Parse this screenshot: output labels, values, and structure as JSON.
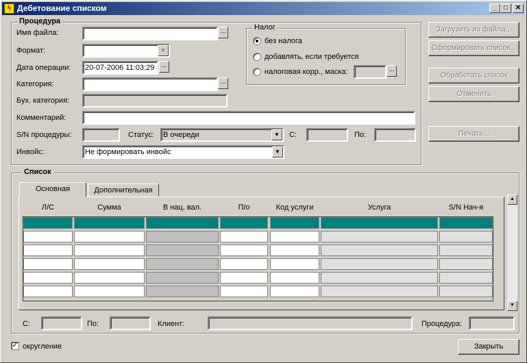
{
  "window": {
    "title": "Дебетование списком",
    "min": "_",
    "max": "□",
    "close": "✕"
  },
  "procedure": {
    "group_title": "Процедура",
    "filename_label": "Имя файла:",
    "format_label": "Формат:",
    "date_label": "Дата операции:",
    "date_value": "20-07-2006 11:03:29",
    "category_label": "Категория:",
    "acct_category_label": "Бух. категория:",
    "comment_label": "Комментарий:",
    "sn_label": "S/N процедуры:",
    "status_label": "Статус:",
    "status_value": "В очереди",
    "from_label": "С:",
    "to_label": "По:",
    "invoice_label": "Инвойс:",
    "invoice_value": "Не формировать инвойс",
    "ellipsis": "..."
  },
  "tax": {
    "group_title": "Налог",
    "opt_none": "без налога",
    "opt_add": "добавлять, если требуется",
    "opt_corr": "налоговая корр., маска:"
  },
  "buttons": {
    "load": "Загрузить из файла...",
    "form": "Сформировать список...",
    "process": "Обработать список",
    "cancel": "Отменить",
    "print": "Печать...",
    "close": "Закрыть"
  },
  "list": {
    "group_title": "Список",
    "tabs": [
      "Основная",
      "Дополнительная"
    ],
    "columns": [
      "Л/С",
      "Сумма",
      "В нац. вал.",
      "П/о",
      "Код услуги",
      "Услуга",
      "S/N Нач-я"
    ],
    "from_label": "С:",
    "to_label": "По:",
    "client_label": "Клиент:",
    "procedure_label": "Процедура:"
  },
  "footer": {
    "rounding_label": "округление",
    "rounding_checked": "✓"
  }
}
